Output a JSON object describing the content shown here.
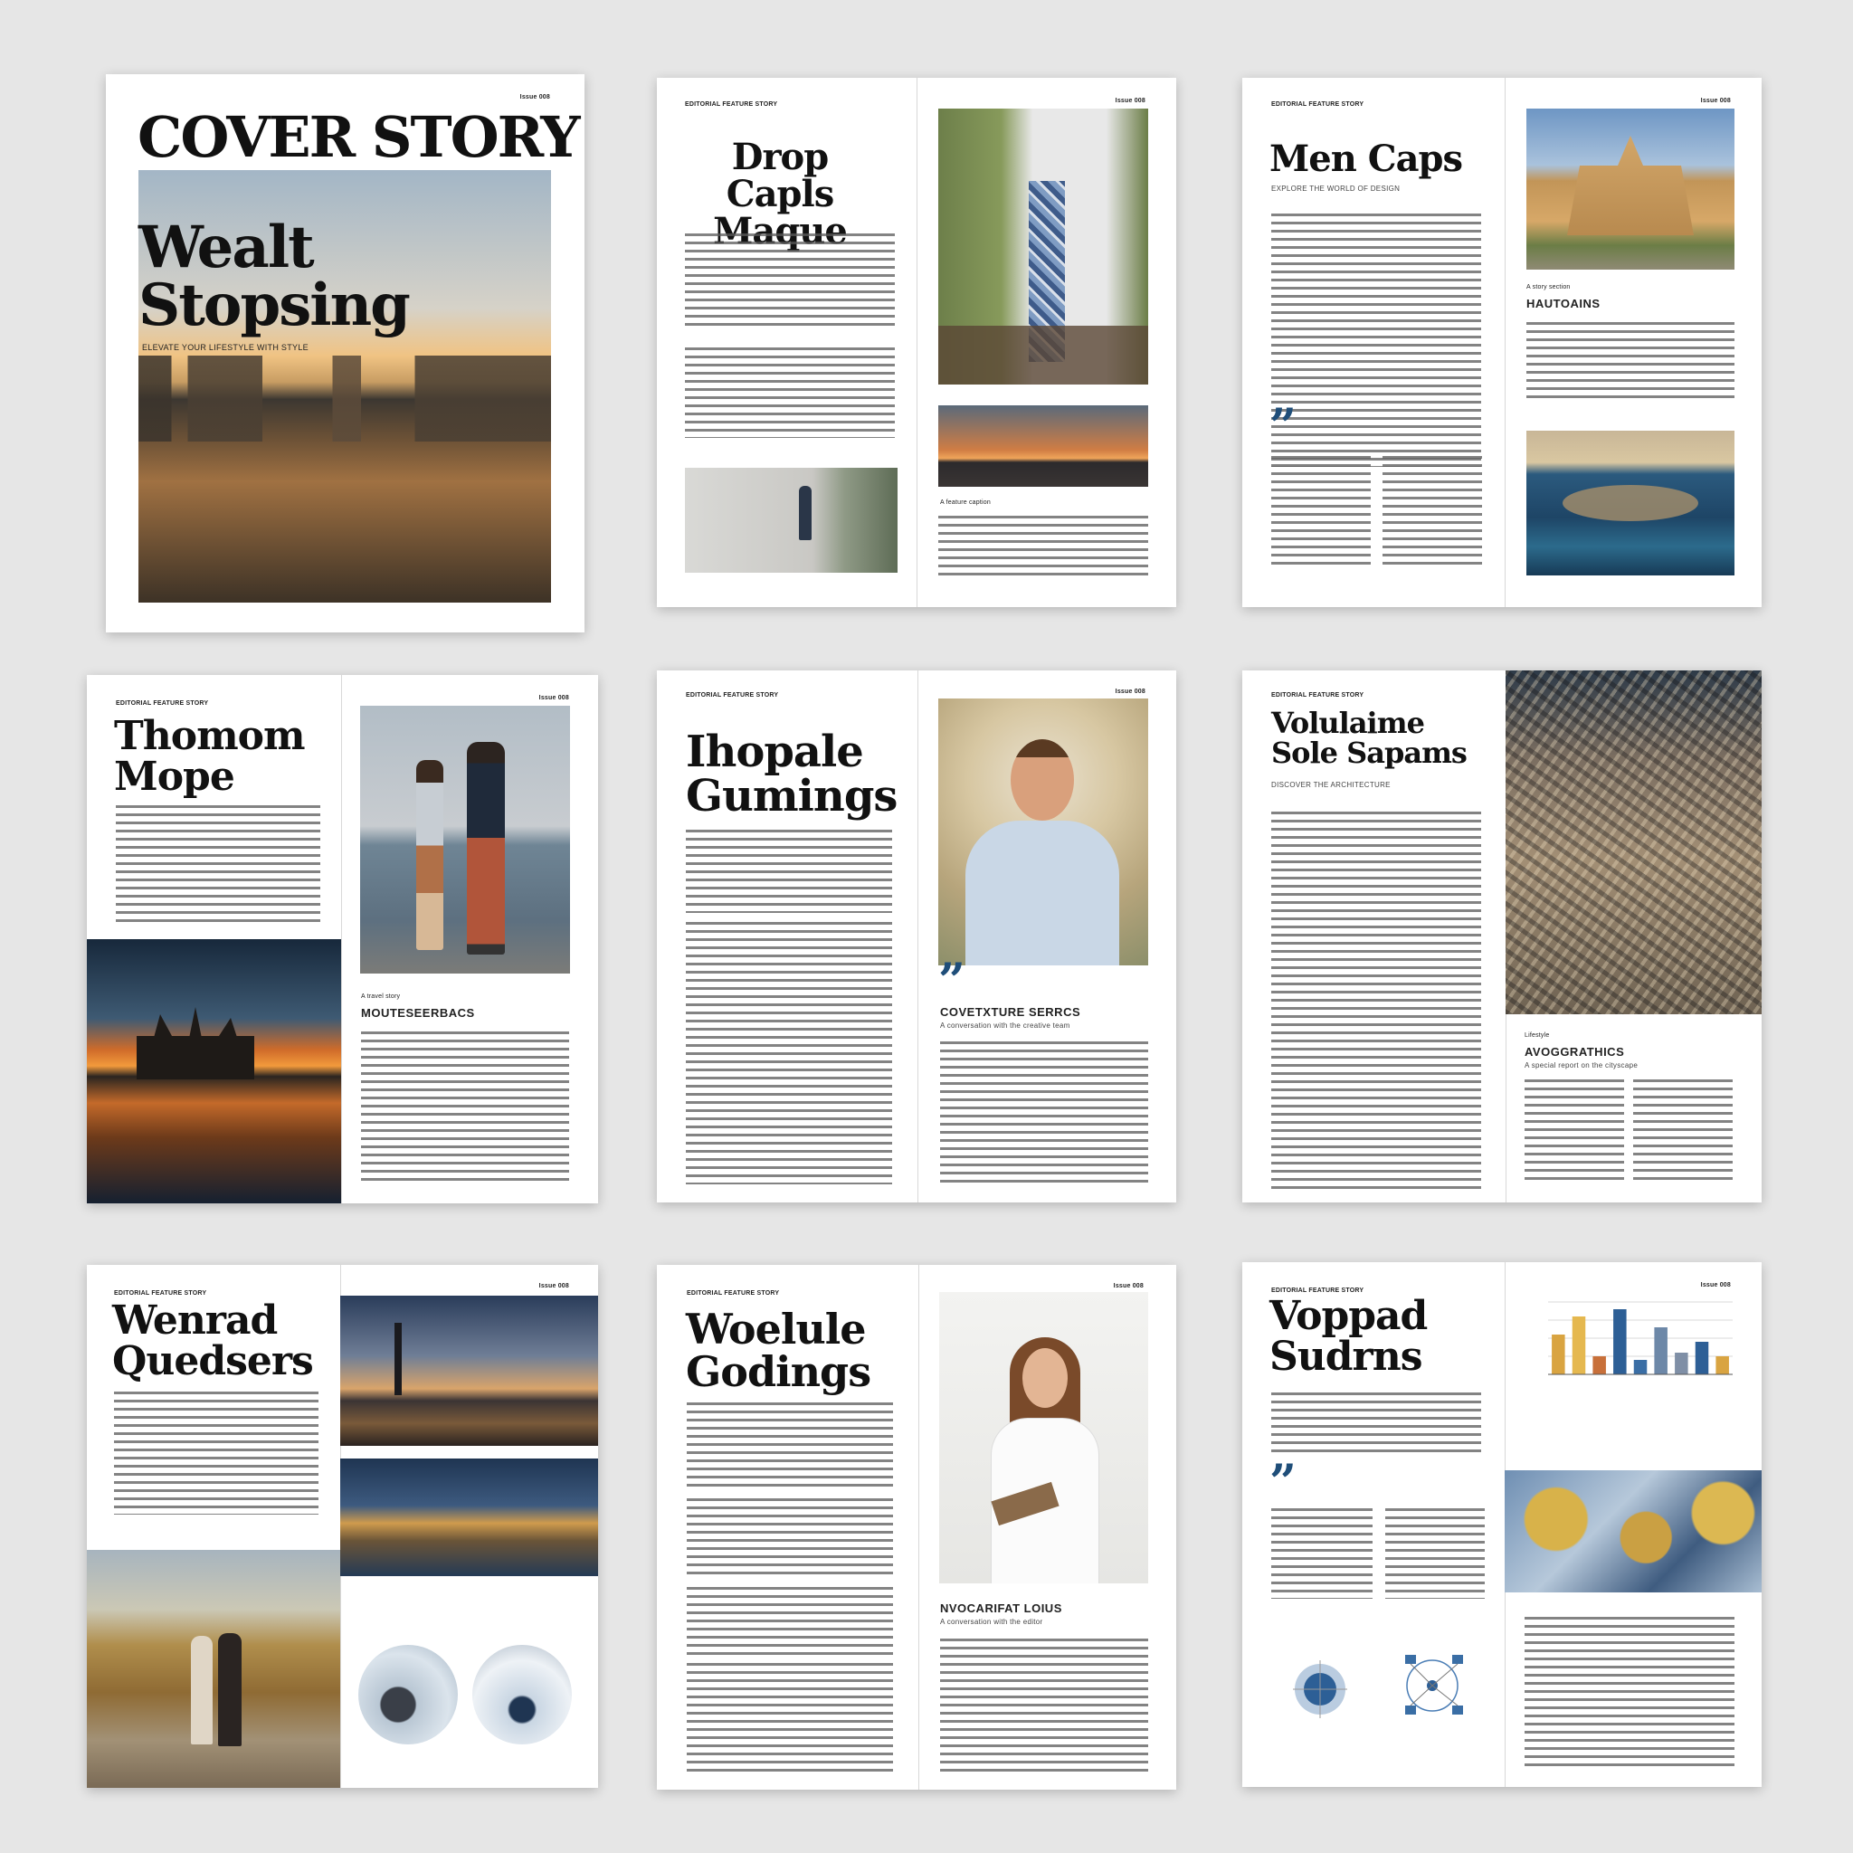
{
  "cover": {
    "issue": "Issue 008",
    "title": "COVER STORY",
    "headline": "Wealt Stopsing",
    "dek": "ELEVATE YOUR LIFESTYLE WITH STYLE"
  },
  "spreads": [
    {
      "kicker": "EDITORIAL FEATURE STORY",
      "page": "Issue 008",
      "title": "Drop Capls Maque",
      "caption": "A feature caption"
    },
    {
      "kicker": "EDITORIAL FEATURE STORY",
      "page": "Issue 008",
      "title": "Men Caps",
      "dek": "EXPLORE THE WORLD OF DESIGN",
      "subkicker": "A story section",
      "sub": "HAUTOAINS"
    },
    {
      "kicker": "EDITORIAL FEATURE STORY",
      "page": "Issue 008",
      "title": "Thomom Mope",
      "subkicker": "A travel story",
      "sub": "MOUTESEERBACS"
    },
    {
      "kicker": "EDITORIAL FEATURE STORY",
      "page": "Issue 008",
      "title": "Ihopale Gumings",
      "sub": "COVETXTURE SERRCS",
      "dek": "A conversation with the creative team"
    },
    {
      "kicker": "EDITORIAL FEATURE STORY",
      "title": "Volulaime Sole Sapams",
      "dek": "DISCOVER THE ARCHITECTURE",
      "subkicker": "Lifestyle",
      "sub": "AVOGGRATHICS",
      "dek2": "A special report on the cityscape"
    },
    {
      "kicker": "EDITORIAL FEATURE STORY",
      "page": "Issue 008",
      "title": "Wenrad Quedsers"
    },
    {
      "kicker": "EDITORIAL FEATURE STORY",
      "page": "Issue 008",
      "title": "Woelule Godings",
      "sub": "NVOCARIFAT LOIUS",
      "dek": "A conversation with the editor"
    },
    {
      "kicker": "EDITORIAL FEATURE STORY",
      "page": "Issue 008",
      "title": "Voppad Sudrns"
    }
  ],
  "chart": {
    "values": [
      55,
      80,
      25,
      90,
      20,
      65,
      30,
      45,
      25
    ]
  },
  "colors": {
    "accent": "#1f4e79",
    "background": "#e6e6e6"
  }
}
